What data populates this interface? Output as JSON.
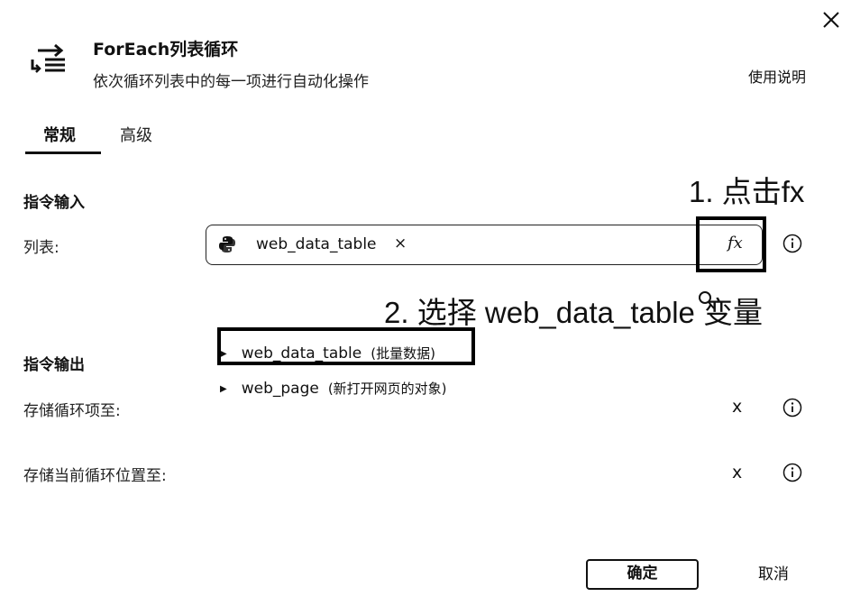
{
  "dialog": {
    "title": "ForEach列表循环",
    "subtitle": "依次循环列表中的每一项进行自动化操作",
    "help_link": "使用说明"
  },
  "tabs": [
    {
      "label": "常规",
      "active": true
    },
    {
      "label": "高级",
      "active": false
    }
  ],
  "input_section": {
    "title": "指令输入",
    "list_label": "列表:",
    "list_value": "web_data_table",
    "remove_glyph": "×",
    "fx_label": "fx"
  },
  "annotations": {
    "step1": "1. 点击fx",
    "step2": "2. 选择 web_data_table 变量"
  },
  "dropdown": [
    {
      "name": "web_data_table",
      "note": "(批量数据)"
    },
    {
      "name": "web_page",
      "note": "(新打开网页的对象)"
    }
  ],
  "output_section": {
    "title": "指令输出",
    "store_item_label": "存储循环项至:",
    "store_index_label": "存储当前循环位置至:",
    "fx_partial": "x"
  },
  "footer": {
    "confirm": "确定",
    "cancel": "取消"
  },
  "icons": {
    "close": "close-icon",
    "app": "loop-list-icon",
    "python": "python-icon",
    "info": "info-icon",
    "cursor": "mouse-cursor-icon"
  }
}
